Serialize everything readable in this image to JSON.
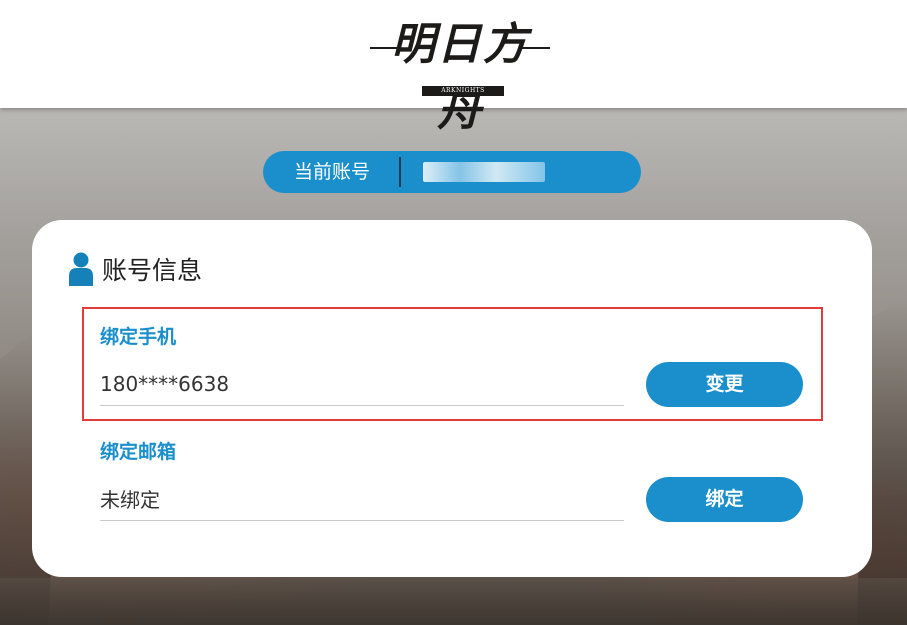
{
  "header": {
    "logo_text": "明日方舟",
    "logo_subtext": "ARKNIGHTS"
  },
  "account": {
    "label": "当前账号",
    "value": ""
  },
  "card": {
    "title": "账号信息",
    "fields": [
      {
        "label": "绑定手机",
        "value": "180****6638",
        "button": "变更"
      },
      {
        "label": "绑定邮箱",
        "value": "未绑定",
        "button": "绑定"
      }
    ]
  },
  "colors": {
    "accent": "#1a8fcb",
    "highlight_border": "#e03c3c",
    "icon": "#1680b8"
  },
  "icons": {
    "card_title": "user-icon"
  }
}
